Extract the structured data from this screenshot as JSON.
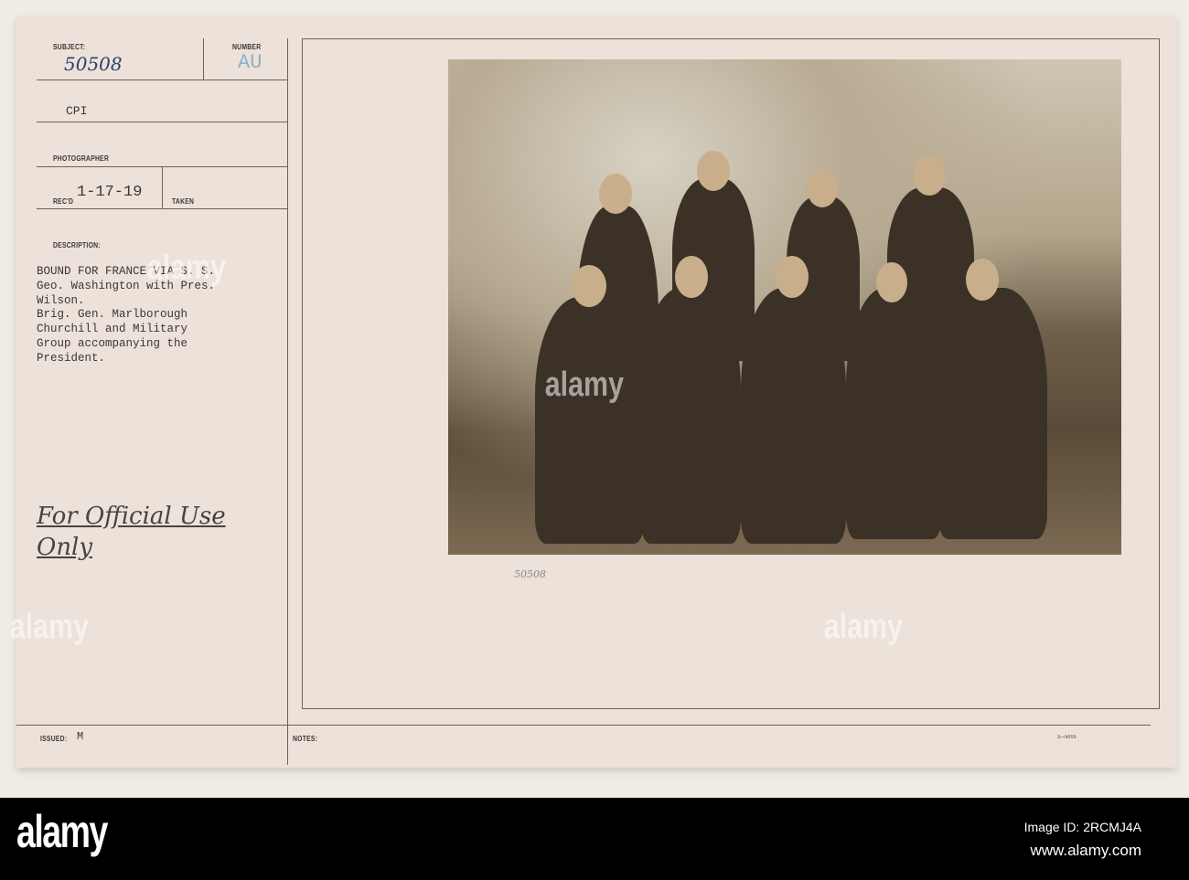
{
  "card": {
    "subject_label": "SUBJECT:",
    "subject_value": "50508",
    "number_label": "NUMBER",
    "number_value": "AU",
    "source": "CPI",
    "photographer_label": "PHOTOGRAPHER",
    "recd_label": "REC'D",
    "recd_value": "1-17-19",
    "taken_label": "TAKEN",
    "description_label": "DESCRIPTION:",
    "description_lines": [
      "BOUND FOR FRANCE VIA S. S.",
      "Geo. Washington with Pres.",
      "Wilson.",
      "Brig. Gen. Marlborough",
      "Churchill and Military",
      "Group accompanying the",
      "President."
    ],
    "handwritten_note": "For Official Use Only",
    "photo_number": "50508",
    "issued_label": "ISSUED:",
    "issued_value": "M",
    "notes_label": "NOTES:",
    "form_number": "3—5005"
  },
  "footer": {
    "logo": "alamy",
    "image_id": "Image ID: 2RCMJ4A",
    "url": "www.alamy.com"
  },
  "watermark": "alamy"
}
